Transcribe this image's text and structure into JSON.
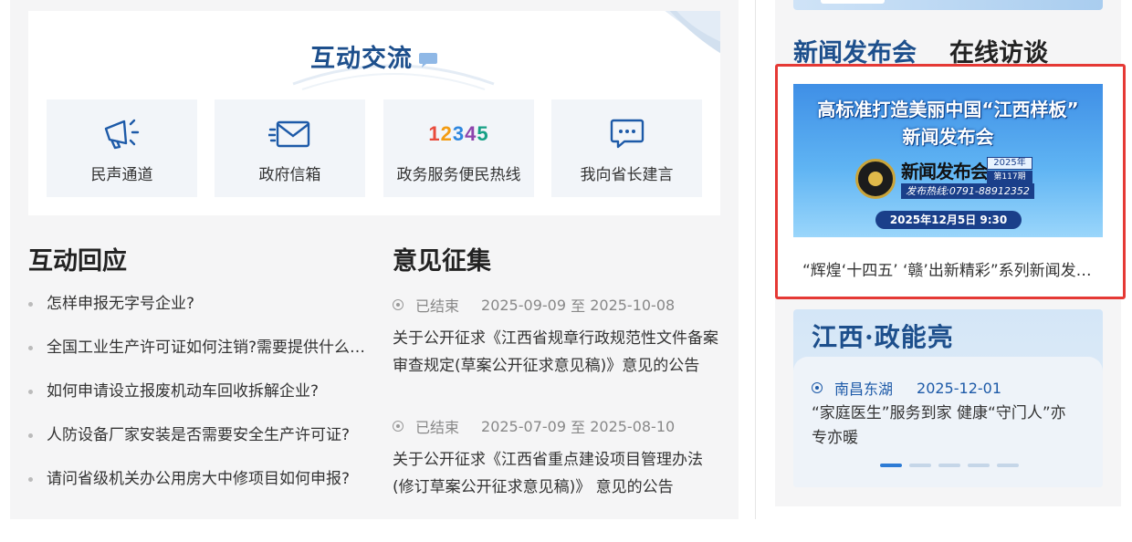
{
  "interact": {
    "title": "互动交流",
    "tiles": [
      {
        "label": "民声通道",
        "icon": "megaphone-icon"
      },
      {
        "label": "政府信箱",
        "icon": "envelope-icon"
      },
      {
        "label": "政务服务便民热线",
        "icon": "hotline-12345-icon",
        "digits": [
          "1",
          "2",
          "3",
          "4",
          "5"
        ]
      },
      {
        "label": "我向省长建言",
        "icon": "chat-bubble-icon"
      }
    ]
  },
  "response": {
    "title": "互动回应",
    "items": [
      "怎样申报无字号企业?",
      "全国工业生产许可证如何注销?需要提供什么材料?",
      "如何申请设立报废机动车回收拆解企业?",
      "人防设备厂家安装是否需要安全生产许可证?",
      "请问省级机关办公用房大中修项目如何申报?"
    ]
  },
  "opinion": {
    "title": "意见征集",
    "items": [
      {
        "status": "已结束",
        "start": "2025-09-09",
        "sep": "至",
        "end": "2025-10-08",
        "text": "关于公开征求《江西省规章行政规范性文件备案审查规定(草案公开征求意见稿)》意见的公告"
      },
      {
        "status": "已结束",
        "start": "2025-07-09",
        "sep": "至",
        "end": "2025-08-10",
        "text": "关于公开征求《江西省重点建设项目管理办法(修订草案公开征求意见稿)》 意见的公告"
      }
    ]
  },
  "press": {
    "tabs": [
      "新闻发布会",
      "在线访谈"
    ],
    "active_tab": 0,
    "banner": {
      "title_line1": "高标准打造美丽中国“江西样板”",
      "title_line2": "新闻发布会",
      "brand": "新闻发布会",
      "year": "2025年",
      "issue": "第117期",
      "hotline": "发布热线:0791-88912352",
      "date": "2025年12月5日 9:30"
    },
    "caption": "“辉煌‘十四五’ ‘赣’出新精彩”系列新闻发布会"
  },
  "jiangxi": {
    "title": "江西·政能亮",
    "source": "南昌东湖",
    "date": "2025-12-01",
    "text": "“家庭医生”服务到家 健康“守门人”亦专亦暖",
    "dots": 5,
    "active_dot": 0
  },
  "colors": {
    "accent": "#1d4f8c",
    "highlight": "#e53935",
    "link_blue": "#1d5aa8"
  }
}
